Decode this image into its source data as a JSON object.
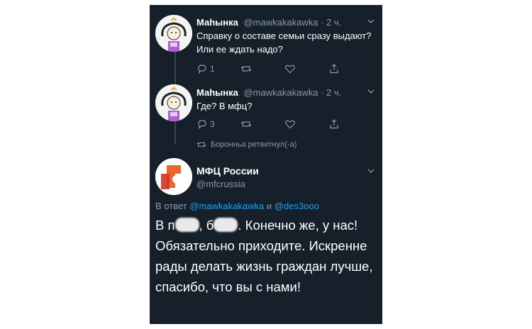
{
  "thread": [
    {
      "name": "Маhынка",
      "handle": "@mawkakakawka",
      "time": "· 2 ч.",
      "text": "Справку о составе семьи сразу выдают? Или ее ждать надо?",
      "replies": "1"
    },
    {
      "name": "Маhынка",
      "handle": "@mawkakakawka",
      "time": "· 2 ч.",
      "text": "Где? В мфц?",
      "replies": "3"
    }
  ],
  "retweeted_by": "Боронньа ретвитнул(-а)",
  "main_tweet": {
    "name": "МФЦ России",
    "handle": "@mfcrussia",
    "reply_prefix": "В ответ",
    "reply_user1": "@mawkakakawka",
    "reply_and": "и",
    "reply_user2": "@des3ooo",
    "text_start": "В п",
    "text_mid": ", б",
    "text_rest": ". Конечно же, у нас! Обязательно приходите. Искренне рады делать жизнь граждан лучше, спасибо, что вы с нами!"
  },
  "icons": [
    "reply-icon",
    "retweet-icon",
    "like-icon",
    "share-icon",
    "chevron-down-icon"
  ],
  "colors": {
    "background": "#15202b",
    "text": "#ffffff",
    "secondary": "#8899a6",
    "link": "#1da1f2",
    "mfc_orange": "#e8672a",
    "mfc_red": "#d6312a"
  }
}
